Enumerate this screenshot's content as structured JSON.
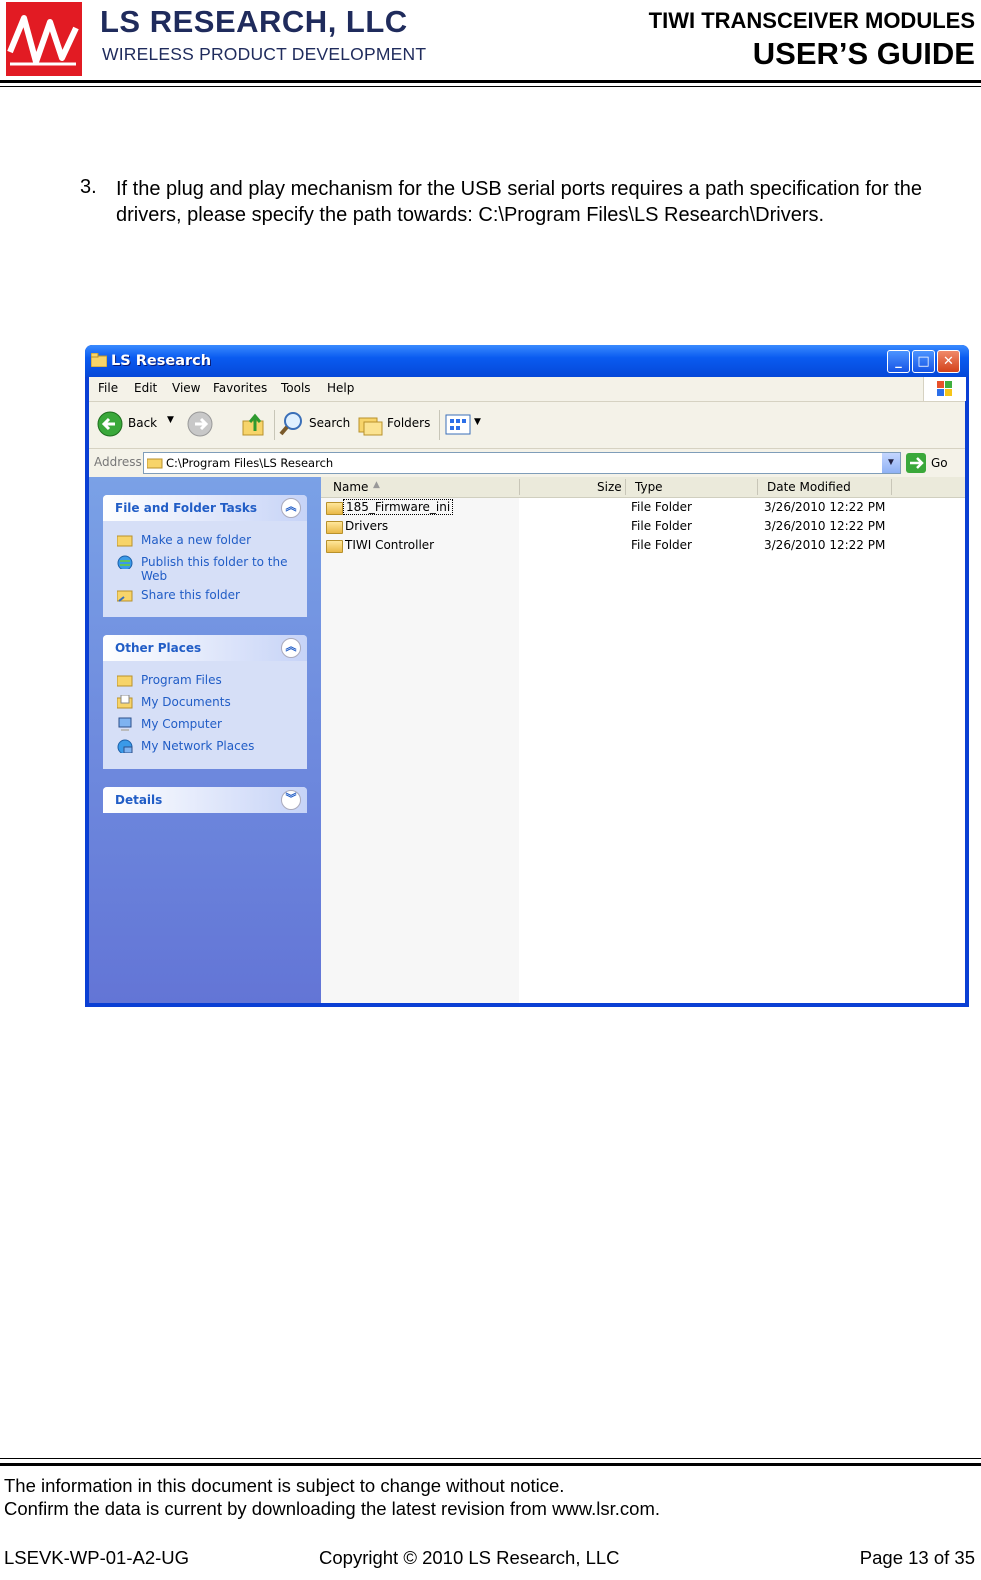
{
  "header": {
    "company": "LS RESEARCH, LLC",
    "division": "WIRELESS PRODUCT DEVELOPMENT",
    "doc_title": "TIWI TRANSCEIVER MODULES",
    "doc_subtitle": "USER’S GUIDE"
  },
  "step": {
    "number": "3.",
    "text": "If the plug and play mechanism for the USB serial ports requires a path specification for the drivers, please specify the path towards: C:\\Program Files\\LS Research\\Drivers."
  },
  "window": {
    "title": "LS Research",
    "menu": [
      "File",
      "Edit",
      "View",
      "Favorites",
      "Tools",
      "Help"
    ],
    "toolbar": {
      "back": "Back",
      "search": "Search",
      "folders": "Folders"
    },
    "address_label": "Address",
    "address_value": "C:\\Program Files\\LS Research",
    "go": "Go",
    "panels": [
      {
        "title": "File and Folder Tasks",
        "links": [
          "Make a new folder",
          "Publish this folder to the Web",
          "Share this folder"
        ]
      },
      {
        "title": "Other Places",
        "links": [
          "Program Files",
          "My Documents",
          "My Computer",
          "My Network Places"
        ]
      },
      {
        "title": "Details",
        "links": []
      }
    ],
    "columns": [
      "Name",
      "Size",
      "Type",
      "Date Modified"
    ],
    "rows": [
      {
        "name": "185_Firmware_ini",
        "type": "File Folder",
        "date": "3/26/2010 12:22 PM"
      },
      {
        "name": "Drivers",
        "type": "File Folder",
        "date": "3/26/2010 12:22 PM"
      },
      {
        "name": "TIWI Controller",
        "type": "File Folder",
        "date": "3/26/2010 12:22 PM"
      }
    ]
  },
  "footer": {
    "notice1": "The information in this document is subject to change without notice.",
    "notice2": "Confirm the data is current by downloading the latest revision from www.lsr.com.",
    "doc_id": "LSEVK-WP-01-A2-UG",
    "copyright": "Copyright © 2010 LS Research, LLC",
    "page": "Page 13 of 35"
  },
  "colors": {
    "brand_red": "#e21b23",
    "brand_navy": "#1f2b5c",
    "xp_blue": "#0a3fd4"
  }
}
